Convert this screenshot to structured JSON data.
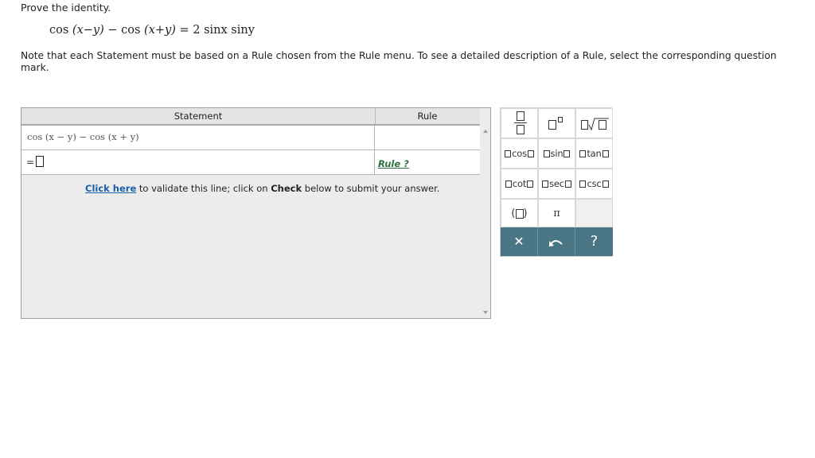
{
  "prompt": "Prove the identity.",
  "identity": {
    "lhs_a": "cos",
    "lhs_a_arg": "(x−y)",
    "minus": " − ",
    "lhs_b": "cos",
    "lhs_b_arg": "(x+y)",
    "equals": " = ",
    "rhs": "2 sinx siny"
  },
  "note": "Note that each Statement must be based on a Rule chosen from the Rule menu. To see a detailed description of a Rule, select the corresponding question mark.",
  "proof": {
    "headers": {
      "statement": "Statement",
      "rule": "Rule"
    },
    "row1": {
      "statement": "cos (x − y) − cos (x + y)"
    },
    "row2": {
      "eq": "=",
      "rule_link": "Rule ?"
    },
    "validate": {
      "link": "Click here",
      "text1": " to validate this line; click on ",
      "bold": "Check",
      "text2": " below to submit your answer."
    }
  },
  "palette": {
    "cos": "cos",
    "sin": "sin",
    "tan": "tan",
    "cot": "cot",
    "sec": "sec",
    "csc": "csc",
    "paren_open": "(",
    "paren_close": ")",
    "pi": "π",
    "clear": "✕",
    "undo": "↶",
    "help": "?"
  },
  "colors": {
    "action_bar": "#4a7585",
    "rule_link": "#2f6e3f",
    "validate_link": "#1a5fa8"
  },
  "icons": [
    "fraction-icon",
    "exponent-icon",
    "nth-root-icon",
    "clear-icon",
    "undo-icon",
    "help-icon"
  ]
}
